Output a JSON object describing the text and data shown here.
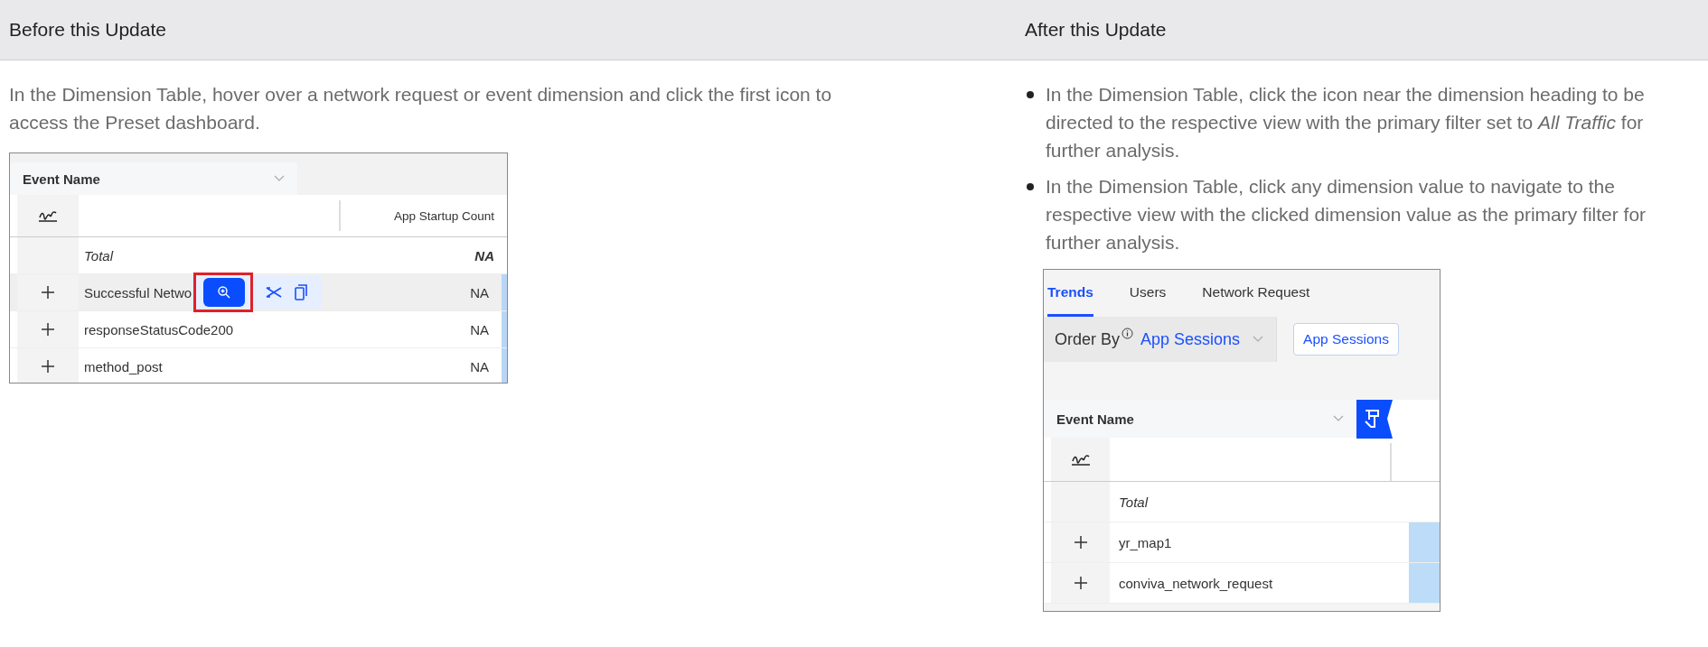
{
  "columns": [
    {
      "heading": "Before this Update"
    },
    {
      "heading": "After this Update"
    }
  ],
  "before": {
    "text": "In the Dimension Table, hover over a network request or event dimension and click the first icon to access the Preset dashboard.",
    "screenshot": {
      "dimension": "Event Name",
      "metric_column": "App Startup Count",
      "total": {
        "label": "Total",
        "value": "NA"
      },
      "rows": [
        {
          "name": "Successful Netwo",
          "value": "NA",
          "hovered": true
        },
        {
          "name": "responseStatusCode200",
          "value": "NA",
          "hovered": false
        },
        {
          "name": "method_post",
          "value": "NA",
          "hovered": false
        }
      ]
    }
  },
  "after": {
    "bullets": [
      "In the Dimension Table, click the icon near the dimension heading to be directed to the respective view with the primary filter set to *All Traffic* for further analysis.",
      "In the Dimension Table, click any dimension value to navigate to the respective view with the clicked dimension value as the primary filter for further analysis."
    ],
    "screenshot": {
      "tabs": [
        {
          "label": "Trends",
          "selected": true
        },
        {
          "label": "Users",
          "selected": false
        },
        {
          "label": "Network Request",
          "selected": false
        }
      ],
      "order_by": {
        "label": "Order By",
        "value": "App Sessions",
        "button": "App Sessions"
      },
      "dimension": "Event Name",
      "total": "Total",
      "rows": [
        {
          "name": "yr_map1"
        },
        {
          "name": "conviva_network_request"
        }
      ]
    }
  }
}
